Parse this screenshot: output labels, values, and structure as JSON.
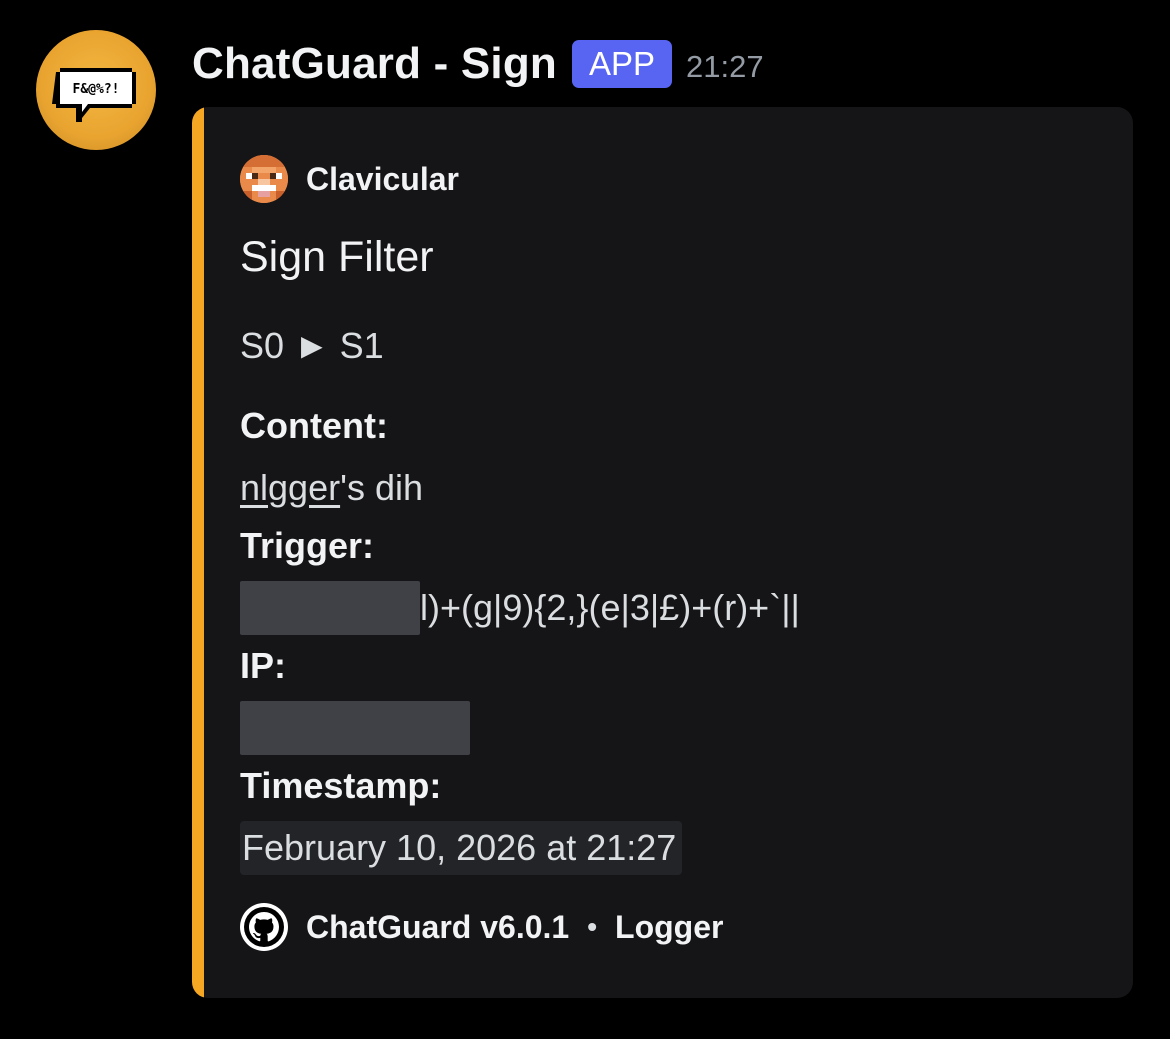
{
  "message": {
    "username": "ChatGuard - Sign",
    "badge": "APP",
    "time": "21:27",
    "avatar_icon": "speech-bubble-profanity-icon",
    "avatar_text": "F&@%?!"
  },
  "embed": {
    "accent_color": "#f5a623",
    "author": {
      "name": "Clavicular",
      "icon": "player-head-icon"
    },
    "title": "Sign Filter",
    "description": "S0 ► S1",
    "fields": {
      "content_name": "Content:",
      "content_link": "nlgger",
      "content_rest": "'s dih",
      "trigger_name": "Trigger:",
      "trigger_visible": "l)+(g|9){2,}(e|3|£)+(r)+`||",
      "ip_name": "IP:",
      "timestamp_name": "Timestamp:",
      "timestamp_value": "February 10, 2026 at 21:27"
    },
    "footer": {
      "icon": "github-icon",
      "text": "ChatGuard v6.0.1",
      "separator": "•",
      "label": "Logger"
    }
  },
  "colors": {
    "background": "#000000",
    "embed_background": "#151517",
    "badge": "#5865f2",
    "spoiler": "#3f4147"
  }
}
